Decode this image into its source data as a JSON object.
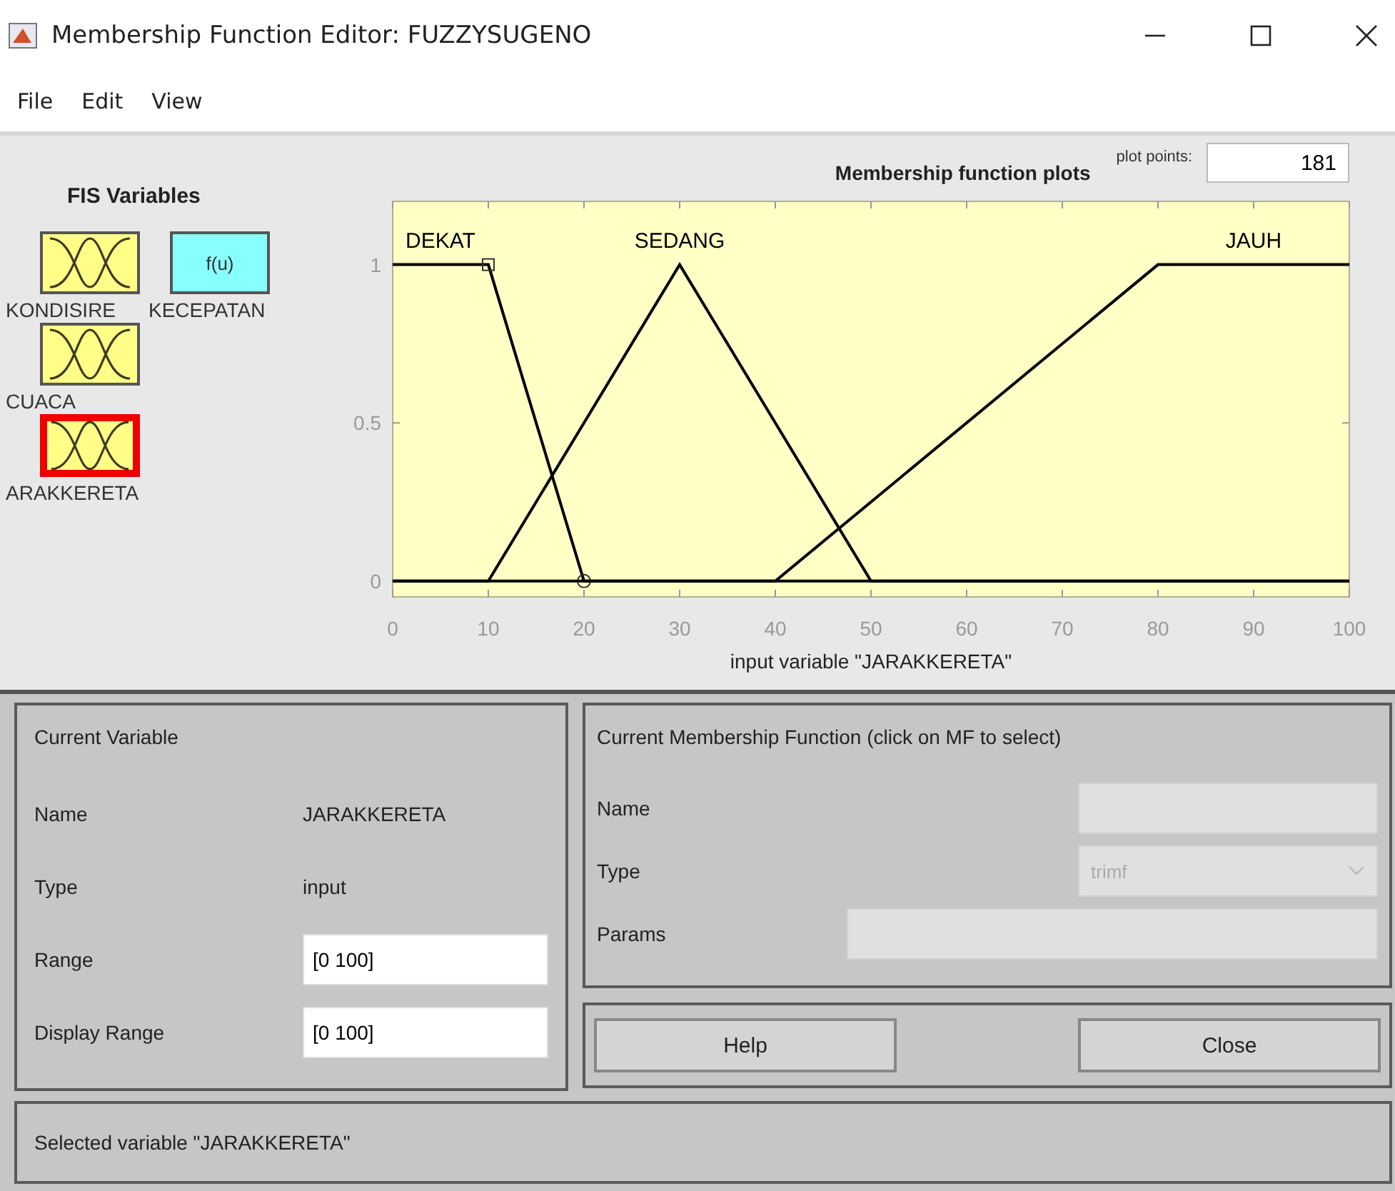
{
  "window": {
    "title": "Membership Function Editor: FUZZYSUGENO"
  },
  "menu": [
    "File",
    "Edit",
    "View"
  ],
  "fis_variables": {
    "title": "FIS Variables",
    "items": [
      {
        "label": "KONDISIRE",
        "kind": "input",
        "selected": false
      },
      {
        "label": "KECEPATAN",
        "kind": "output",
        "symbol": "f(u)",
        "selected": false
      },
      {
        "label": "CUACA",
        "kind": "input",
        "selected": false
      },
      {
        "label": "ARAKKERETA",
        "kind": "input",
        "selected": true
      }
    ]
  },
  "plot": {
    "plot_points_label": "plot points:",
    "plot_points": "181",
    "chart_data": {
      "type": "line",
      "title": "Membership function plots",
      "xlabel": "input variable \"JARAKKERETA\"",
      "x": [
        0,
        10,
        20,
        30,
        40,
        50,
        80,
        100
      ],
      "series": [
        {
          "name": "DEKAT",
          "color": "#000000",
          "values": [
            1,
            1,
            0,
            0,
            0,
            0,
            0,
            0
          ]
        },
        {
          "name": "SEDANG",
          "color": "#000000",
          "values": [
            0,
            0,
            0.5,
            1,
            0.5,
            0,
            0,
            0
          ]
        },
        {
          "name": "JAUH",
          "color": "#000000",
          "values": [
            0,
            0,
            0,
            0,
            0,
            0.25,
            1,
            1
          ]
        }
      ],
      "xlim": [
        0,
        100
      ],
      "ylim": [
        -0.05,
        1.2
      ],
      "xticks": [
        0,
        10,
        20,
        30,
        40,
        50,
        60,
        70,
        80,
        90,
        100
      ],
      "yticks": [
        0,
        {
          "value": 0.5,
          "label": "0.5"
        },
        1
      ]
    }
  },
  "current_variable": {
    "title": "Current Variable",
    "rows": [
      {
        "label": "Name",
        "value": "JARAKKERETA",
        "kind": "text"
      },
      {
        "label": "Type",
        "value": "input",
        "kind": "text"
      },
      {
        "label": "Range",
        "value": "[0 100]",
        "kind": "field"
      },
      {
        "label": "Display Range",
        "value": "[0 100]",
        "kind": "field"
      }
    ]
  },
  "current_mf": {
    "title": "Current Membership Function (click on MF to select)",
    "rows": [
      {
        "label": "Name",
        "kind": "field"
      },
      {
        "label": "Type",
        "value": "trimf",
        "kind": "select"
      },
      {
        "label": "Params",
        "kind": "wide_field"
      }
    ]
  },
  "buttons": [
    "Help",
    "Close"
  ],
  "status_bar": "Selected variable \"JARAKKERETA\""
}
